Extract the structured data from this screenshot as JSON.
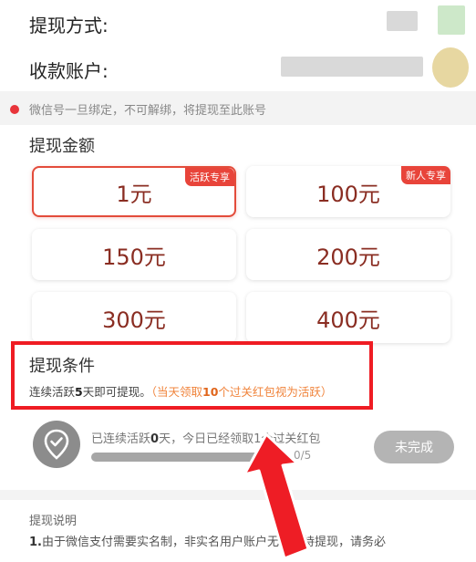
{
  "withdraw_method": {
    "label": "提现方式:"
  },
  "receive_account": {
    "label": "收款账户:"
  },
  "notice": "微信号一旦绑定，不可解绑，将提现至此账号",
  "amount_section": {
    "title": "提现金额",
    "options": [
      {
        "label": "1元",
        "tag": "活跃专享",
        "selected": true
      },
      {
        "label": "100元",
        "tag": "新人专享",
        "selected": false
      },
      {
        "label": "150元",
        "tag": "",
        "selected": false
      },
      {
        "label": "200元",
        "tag": "",
        "selected": false
      },
      {
        "label": "300元",
        "tag": "",
        "selected": false
      },
      {
        "label": "400元",
        "tag": "",
        "selected": false
      }
    ]
  },
  "conditions": {
    "title": "提现条件",
    "text_pre": "连续活跃",
    "days": "5",
    "text_mid": "天即可提现。",
    "note_pre": "（当天领取",
    "note_count": "10",
    "note_post": "个过关红包视为活跃）"
  },
  "progress": {
    "text_pre": "已连续活跃",
    "active_days": "0",
    "text_mid": "天，今日已经领取",
    "claimed": "1",
    "text_post": "个过关红包",
    "count": "0/5",
    "fraction": 0,
    "status_button": "未完成"
  },
  "explanation": {
    "title": "提现说明",
    "num": "1.",
    "text": "由于微信支付需要实名制，非实名用户账户无法支持提现，请务必"
  },
  "colors": {
    "accent": "#e34c3b",
    "highlight_box": "#ef1c23",
    "amount_text": "#8a2d22",
    "note_orange": "#f0843c"
  }
}
